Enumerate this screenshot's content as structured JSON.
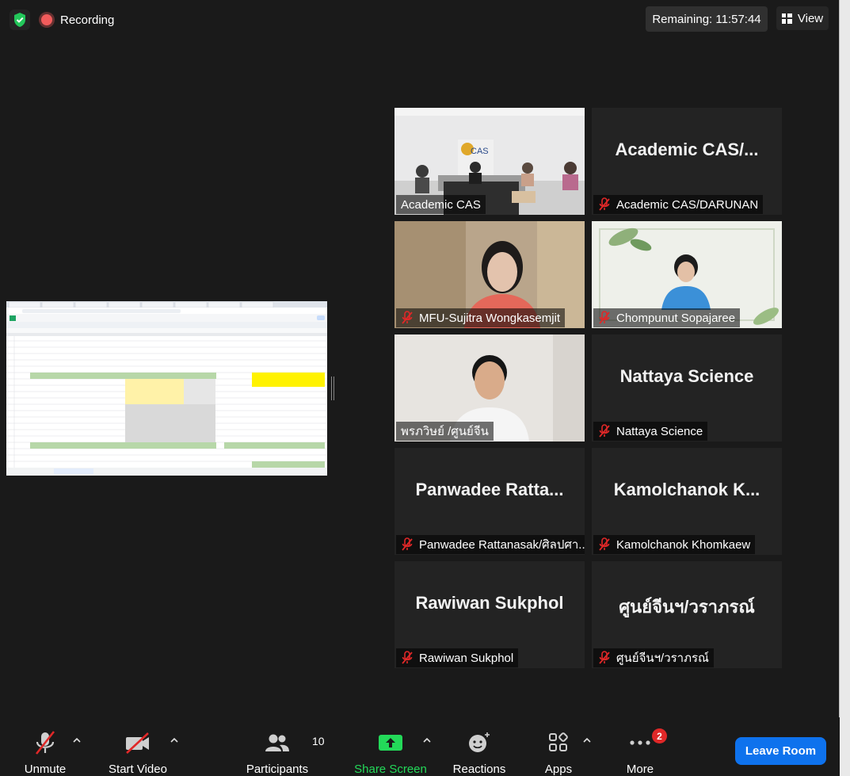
{
  "header": {
    "recording_label": "Recording",
    "remaining_label": "Remaining: 11:57:44",
    "view_label": "View"
  },
  "participants": [
    {
      "name": "Academic CAS",
      "display": "",
      "video": true,
      "active": true
    },
    {
      "name": "Academic CAS/DARUNAN",
      "display": "Academic  CAS/...",
      "video": false
    },
    {
      "name": "MFU-Sujitra Wongkasemjit",
      "display": "",
      "video": true
    },
    {
      "name": "Chompunut Sopajaree",
      "display": "",
      "video": true
    },
    {
      "name": "พรภวิษย์ /ศูนย์จีน",
      "display": "",
      "video": true
    },
    {
      "name": "Nattaya Science",
      "display": "Nattaya Science",
      "video": false
    },
    {
      "name": "Panwadee Rattanasak/ศิลปศา...",
      "display": "Panwadee  Ratta...",
      "video": false
    },
    {
      "name": "Kamolchanok Khomkaew",
      "display": "Kamolchanok  K...",
      "video": false
    },
    {
      "name": "Rawiwan Sukphol",
      "display": "Rawiwan Sukphol",
      "video": false
    },
    {
      "name": "ศูนย์จีนฯ/วราภรณ์",
      "display": "ศูนย์จีนฯ/วราภรณ์",
      "video": false
    }
  ],
  "toolbar": {
    "unmute": "Unmute",
    "start_video": "Start Video",
    "participants": "Participants",
    "participants_count": "10",
    "share_screen": "Share Screen",
    "reactions": "Reactions",
    "apps": "Apps",
    "more": "More",
    "more_badge": "2",
    "leave": "Leave Room"
  },
  "colors": {
    "accent_blue": "#0e72ed",
    "share_green": "#23d959",
    "active_speaker": "#b6d86a",
    "muted_red": "#e02828"
  }
}
